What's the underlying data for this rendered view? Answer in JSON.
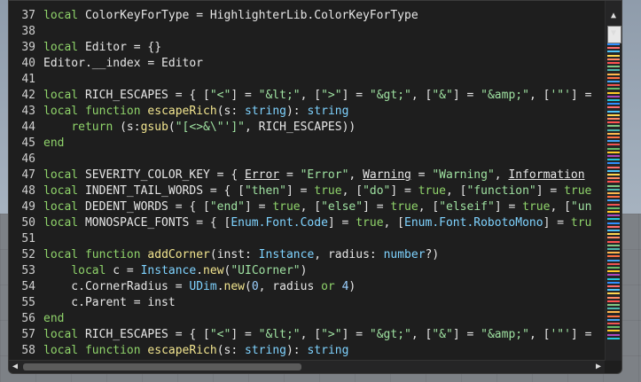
{
  "editor": {
    "lines": [
      {
        "n": "37",
        "html": "<span class=\"kw\">local</span> ColorKeyForType = HighlighterLib.ColorKeyForType"
      },
      {
        "n": "38",
        "html": ""
      },
      {
        "n": "39",
        "html": "<span class=\"kw\">local</span> Editor = {}"
      },
      {
        "n": "40",
        "html": "Editor.__index = Editor"
      },
      {
        "n": "41",
        "html": ""
      },
      {
        "n": "42",
        "html": "<span class=\"kw\">local</span> RICH_ESCAPES = { [<span class=\"str\">\"&lt;\"</span>] = <span class=\"str\">\"&amp;lt;\"</span>, [<span class=\"str\">\"&gt;\"</span>] = <span class=\"str\">\"&amp;gt;\"</span>, [<span class=\"str\">\"&amp;\"</span>] = <span class=\"str\">\"&amp;amp;\"</span>, [<span class=\"str\">'\"'</span>] ="
      },
      {
        "n": "43",
        "html": "<span class=\"kw\">local</span> <span class=\"kw\">function</span> <span class=\"fn\">escapeRich</span>(s: <span class=\"ty\">string</span>): <span class=\"ty\">string</span>"
      },
      {
        "n": "44",
        "html": "    <span class=\"kw\">return</span> (s:<span class=\"fn\">gsub</span>(<span class=\"str\">\"[&lt;&gt;&amp;\\\"']\"</span>, RICH_ESCAPES))"
      },
      {
        "n": "45",
        "html": "<span class=\"kw\">end</span>"
      },
      {
        "n": "46",
        "html": ""
      },
      {
        "n": "47",
        "html": "<span class=\"kw\">local</span> SEVERITY_COLOR_KEY = { <span class=\"ul\">Error</span> = <span class=\"str\">\"Error\"</span>, <span class=\"ul\">Warning</span> = <span class=\"str\">\"Warning\"</span>, <span class=\"ul\">Information</span>"
      },
      {
        "n": "48",
        "html": "<span class=\"kw\">local</span> INDENT_TAIL_WORDS = { [<span class=\"str\">\"then\"</span>] = <span class=\"kw\">true</span>, [<span class=\"str\">\"do\"</span>] = <span class=\"kw\">true</span>, [<span class=\"str\">\"function\"</span>] = <span class=\"kw\">true</span>"
      },
      {
        "n": "49",
        "html": "<span class=\"kw\">local</span> DEDENT_WORDS = { [<span class=\"str\">\"end\"</span>] = <span class=\"kw\">true</span>, [<span class=\"str\">\"else\"</span>] = <span class=\"kw\">true</span>, [<span class=\"str\">\"elseif\"</span>] = <span class=\"kw\">true</span>, [<span class=\"str\">\"un</span>"
      },
      {
        "n": "50",
        "html": "<span class=\"kw\">local</span> MONOSPACE_FONTS = { [<span class=\"ty\">Enum.Font.Code</span>] = <span class=\"kw\">true</span>, [<span class=\"ty\">Enum.Font.RobotoMono</span>] = <span class=\"kw\">tru</span>"
      },
      {
        "n": "51",
        "html": ""
      },
      {
        "n": "52",
        "html": "<span class=\"kw\">local</span> <span class=\"kw\">function</span> <span class=\"fn\">addCorner</span>(inst: <span class=\"ty\">Instance</span>, radius: <span class=\"ty\">number</span>?)"
      },
      {
        "n": "53",
        "html": "    <span class=\"kw\">local</span> c = <span class=\"ty\">Instance</span>.<span class=\"fn\">new</span>(<span class=\"str\">\"UICorner\"</span>)"
      },
      {
        "n": "54",
        "html": "    c.CornerRadius = <span class=\"ty\">UDim</span>.<span class=\"fn\">new</span>(<span class=\"num\">0</span>, radius <span class=\"kw\">or</span> <span class=\"num\">4</span>)"
      },
      {
        "n": "55",
        "html": "    c.Parent = inst"
      },
      {
        "n": "56",
        "html": "<span class=\"kw\">end</span>"
      },
      {
        "n": "57",
        "html": "<span class=\"kw\">local</span> RICH_ESCAPES = { [<span class=\"str\">\"&lt;\"</span>] = <span class=\"str\">\"&amp;lt;\"</span>, [<span class=\"str\">\"&gt;\"</span>] = <span class=\"str\">\"&amp;gt;\"</span>, [<span class=\"str\">\"&amp;\"</span>] = <span class=\"str\">\"&amp;amp;\"</span>, [<span class=\"str\">'\"'</span>] ="
      },
      {
        "n": "58",
        "html": "<span class=\"kw\">local</span> <span class=\"kw\">function</span> <span class=\"fn\">escapeRich</span>(s: <span class=\"ty\">string</span>): <span class=\"ty\">string</span>"
      }
    ],
    "minimap_colors": [
      "#2f8fff",
      "#ff6b6b",
      "#4fc3f7",
      "#ffd54f",
      "#ff8a65",
      "#ff5252",
      "#81c784",
      "#4db6ac",
      "#ffb74d",
      "#ff7043",
      "#42a5f5",
      "#ef5350",
      "#66bb6a",
      "#ffca28",
      "#ab47bc",
      "#26c6da"
    ]
  },
  "icons": {
    "scroll_up": "up-arrow-icon",
    "scroll_down": "down-arrow-icon",
    "scroll_left": "left-arrow-icon",
    "scroll_right": "right-arrow-icon"
  }
}
